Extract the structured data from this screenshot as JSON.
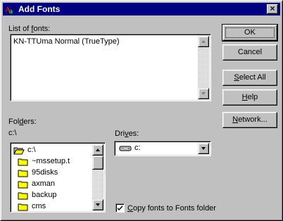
{
  "window": {
    "title": "Add Fonts",
    "close_glyph": "×"
  },
  "fonts_list": {
    "label_pre": "List of ",
    "label_key": "f",
    "label_post": "onts:",
    "items": [
      "KN-TTUma Normal (TrueType)"
    ]
  },
  "buttons": {
    "ok": "OK",
    "cancel": "Cancel",
    "select_all_key": "S",
    "select_all_rest": "elect All",
    "help_key": "H",
    "help_rest": "elp",
    "network_pre": "",
    "network_key": "N",
    "network_rest": "etwork..."
  },
  "folders": {
    "label_pre": "Fol",
    "label_key": "d",
    "label_post": "ers:",
    "path": "c:\\",
    "items": [
      {
        "name": "c:\\",
        "icon": "open-folder-icon"
      },
      {
        "name": "~mssetup.t",
        "icon": "folder-icon"
      },
      {
        "name": "95disks",
        "icon": "folder-icon"
      },
      {
        "name": "axman",
        "icon": "folder-icon"
      },
      {
        "name": "backup",
        "icon": "folder-icon"
      },
      {
        "name": "cms",
        "icon": "folder-icon"
      }
    ]
  },
  "drives": {
    "label_pre": "Dri",
    "label_key": "v",
    "label_post": "es:",
    "selected": "c:",
    "icon": "hard-drive-icon"
  },
  "copy_fonts": {
    "label_key": "C",
    "label_rest": "opy fonts to Fonts folder",
    "checked": true
  },
  "colors": {
    "titlebar": "#000080",
    "face": "#c0c0c0",
    "folder": "#ffff00"
  }
}
